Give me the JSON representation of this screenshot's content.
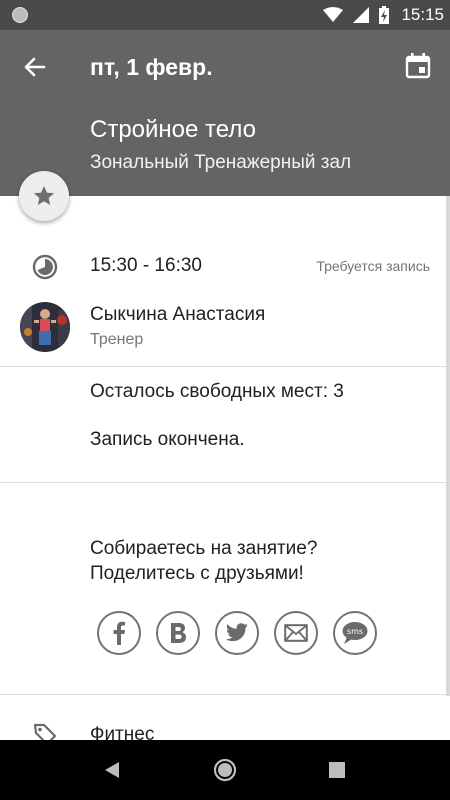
{
  "status_bar": {
    "time": "15:15"
  },
  "app_bar": {
    "date": "пт, 1 февр.",
    "title": "Стройное тело",
    "subtitle": "Зональный Тренажерный зал"
  },
  "session": {
    "time_range": "15:30 - 16:30",
    "booking_note": "Требуется запись"
  },
  "trainer": {
    "name": "Сыкчина Анастасия",
    "role": "Тренер"
  },
  "availability": {
    "seats_text": "Осталось свободных мест: 3",
    "status_text": "Запись окончена."
  },
  "share": {
    "line1": "Собираетесь на занятие?",
    "line2": "Поделитесь с друзьями!",
    "sms_label": "sms"
  },
  "category": {
    "label": "Фитнес"
  },
  "colors": {
    "app_bar": "#646464",
    "status_bar": "#4a4a4a",
    "icon_gray": "#737373"
  }
}
